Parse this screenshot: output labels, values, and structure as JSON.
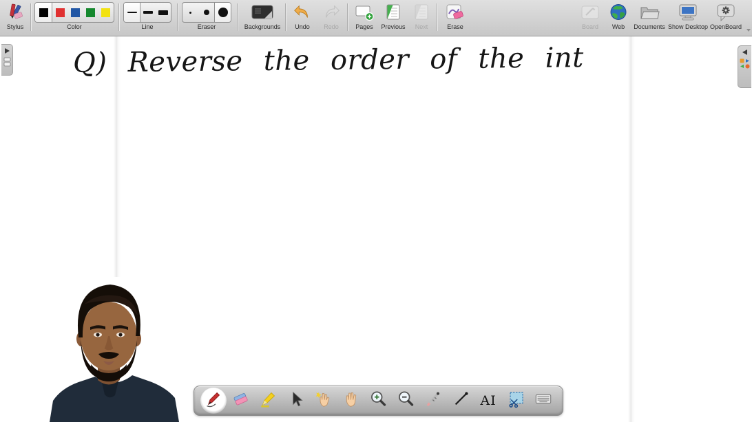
{
  "window": {
    "app_name": "OpenBoard"
  },
  "top_toolbar": {
    "stylus": {
      "label": "Stylus"
    },
    "color": {
      "label": "Color",
      "swatches": [
        "#000000",
        "#e03131",
        "#2257a5",
        "#15882e",
        "#f2e211"
      ],
      "selected_index": 0
    },
    "line": {
      "label": "Line",
      "selected_index": 0
    },
    "eraser": {
      "label": "Eraser",
      "selected_index": 2
    },
    "backgrounds": {
      "label": "Backgrounds"
    },
    "undo": {
      "label": "Undo",
      "enabled": true
    },
    "redo": {
      "label": "Redo",
      "enabled": false
    },
    "pages": {
      "label": "Pages"
    },
    "previous": {
      "label": "Previous",
      "enabled": true
    },
    "next": {
      "label": "Next",
      "enabled": false
    },
    "erase": {
      "label": "Erase"
    },
    "board": {
      "label": "Board",
      "enabled": false
    },
    "web": {
      "label": "Web"
    },
    "documents": {
      "label": "Documents"
    },
    "show_desktop": {
      "label": "Show Desktop"
    },
    "openboard": {
      "label": "OpenBoard"
    }
  },
  "canvas": {
    "handwriting_text": "Q) Reverse the order of the int",
    "ink_color": "#161616"
  },
  "stylus_palette": {
    "selected_tool": "pen",
    "text_tool_glyph": "AI",
    "tools": [
      "pen",
      "eraser",
      "highlighter",
      "selector",
      "play",
      "hand",
      "zoom-in",
      "zoom-out",
      "laser-pointer",
      "line",
      "text",
      "capture",
      "virtual-keyboard"
    ]
  },
  "side_panels": {
    "left_drawer_collapsed": true,
    "right_drawer_collapsed": true
  },
  "webcam_overlay": {
    "type": "presenter-video"
  }
}
